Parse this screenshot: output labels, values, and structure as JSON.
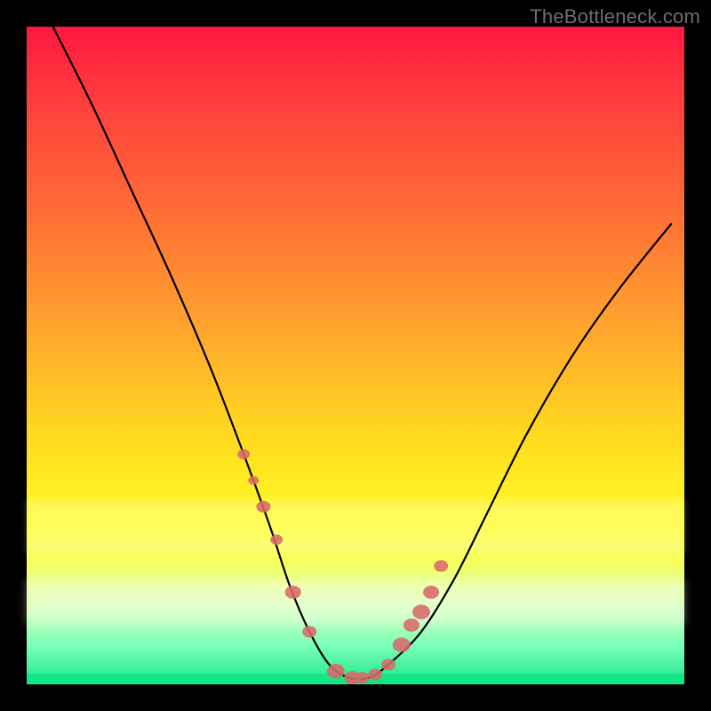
{
  "watermark": "TheBottleneck.com",
  "chart_data": {
    "type": "line",
    "title": "",
    "xlabel": "",
    "ylabel": "",
    "xlim": [
      0,
      100
    ],
    "ylim": [
      0,
      100
    ],
    "series": [
      {
        "name": "bottleneck-curve",
        "x": [
          4,
          10,
          16,
          22,
          28,
          33,
          37,
          40,
          43,
          46,
          49,
          52,
          55,
          60,
          65,
          70,
          76,
          83,
          90,
          98
        ],
        "y": [
          100,
          88,
          75,
          62,
          48,
          35,
          24,
          15,
          8,
          3,
          1,
          1,
          3,
          8,
          16,
          26,
          38,
          50,
          60,
          70
        ]
      }
    ],
    "markers": {
      "name": "highlight-dots",
      "color": "#d86a6a",
      "x": [
        33,
        34.5,
        36,
        38,
        40.5,
        43,
        47,
        49.5,
        51,
        53,
        55,
        57,
        58.5,
        60,
        61.5,
        63
      ],
      "y": [
        35,
        31,
        27,
        22,
        14,
        8,
        2,
        1,
        1,
        1.5,
        3,
        6,
        9,
        11,
        14,
        18
      ],
      "r": [
        7,
        6,
        8,
        7,
        9,
        8,
        10,
        9,
        8,
        8,
        8,
        10,
        9,
        10,
        9,
        8
      ]
    },
    "gradient_stops": [
      {
        "pct": 0,
        "color": "#ff173f"
      },
      {
        "pct": 28,
        "color": "#ff6d36"
      },
      {
        "pct": 62,
        "color": "#ffd91f"
      },
      {
        "pct": 82,
        "color": "#f4ff66"
      },
      {
        "pct": 100,
        "color": "#19e68a"
      }
    ]
  }
}
